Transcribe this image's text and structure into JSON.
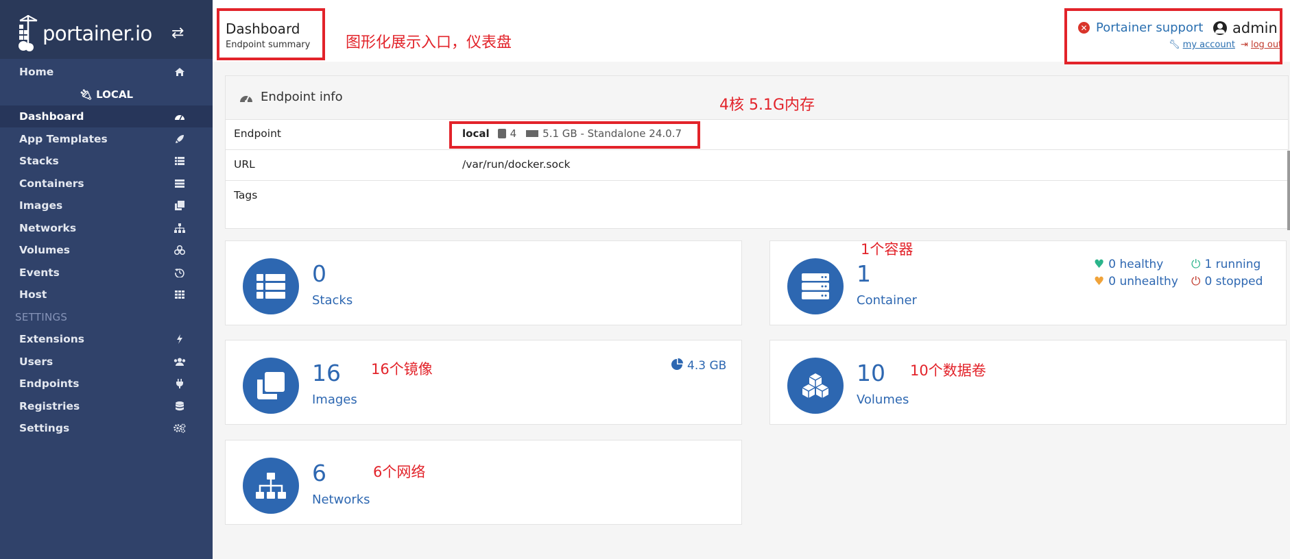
{
  "brand": {
    "name": "portainer.io"
  },
  "sidebar": {
    "items": [
      {
        "label": "Home",
        "icon": "home-icon"
      },
      {
        "label": "Dashboard",
        "icon": "dashboard-icon",
        "active": true
      },
      {
        "label": "App Templates",
        "icon": "rocket-icon"
      },
      {
        "label": "Stacks",
        "icon": "stacks-icon"
      },
      {
        "label": "Containers",
        "icon": "containers-icon"
      },
      {
        "label": "Images",
        "icon": "images-icon"
      },
      {
        "label": "Networks",
        "icon": "networks-icon"
      },
      {
        "label": "Volumes",
        "icon": "volumes-icon"
      },
      {
        "label": "Events",
        "icon": "history-icon"
      },
      {
        "label": "Host",
        "icon": "grid-icon"
      }
    ],
    "endpoint_label": "LOCAL",
    "settings_heading": "SETTINGS",
    "settings_items": [
      {
        "label": "Extensions",
        "icon": "bolt-icon"
      },
      {
        "label": "Users",
        "icon": "users-icon"
      },
      {
        "label": "Endpoints",
        "icon": "plug-icon"
      },
      {
        "label": "Registries",
        "icon": "database-icon"
      },
      {
        "label": "Settings",
        "icon": "gears-icon"
      }
    ]
  },
  "header": {
    "title": "Dashboard",
    "subtitle": "Endpoint summary",
    "annotation": "图形化展示入口，仪表盘",
    "support_label": "Portainer support",
    "user": "admin",
    "my_account": "my account",
    "logout": "log out"
  },
  "endpoint_info": {
    "title": "Endpoint info",
    "annotation": "4核 5.1G内存",
    "rows": {
      "endpoint_key": "Endpoint",
      "endpoint_name": "local",
      "cpu": "4",
      "detail": "5.1 GB - Standalone 24.0.7",
      "url_key": "URL",
      "url_val": "/var/run/docker.sock",
      "tags_key": "Tags"
    }
  },
  "cards": {
    "stacks": {
      "count": "0",
      "label": "Stacks"
    },
    "containers": {
      "count": "1",
      "label": "Container",
      "annotation": "1个容器",
      "healthy": "0 healthy",
      "unhealthy": "0 unhealthy",
      "running": "1 running",
      "stopped": "0 stopped"
    },
    "images": {
      "count": "16",
      "label": "Images",
      "annotation": "16个镜像",
      "size": "4.3 GB"
    },
    "volumes": {
      "count": "10",
      "label": "Volumes",
      "annotation": "10个数据卷"
    },
    "networks": {
      "count": "6",
      "label": "Networks",
      "annotation": "6个网络"
    }
  },
  "colors": {
    "sidebar_bg": "#30426a",
    "accent": "#2d67b1",
    "annotation_red": "#e2232a",
    "healthy_green": "#2bb48b",
    "unhealthy_orange": "#f0a33a",
    "stopped_red": "#c0392b"
  }
}
